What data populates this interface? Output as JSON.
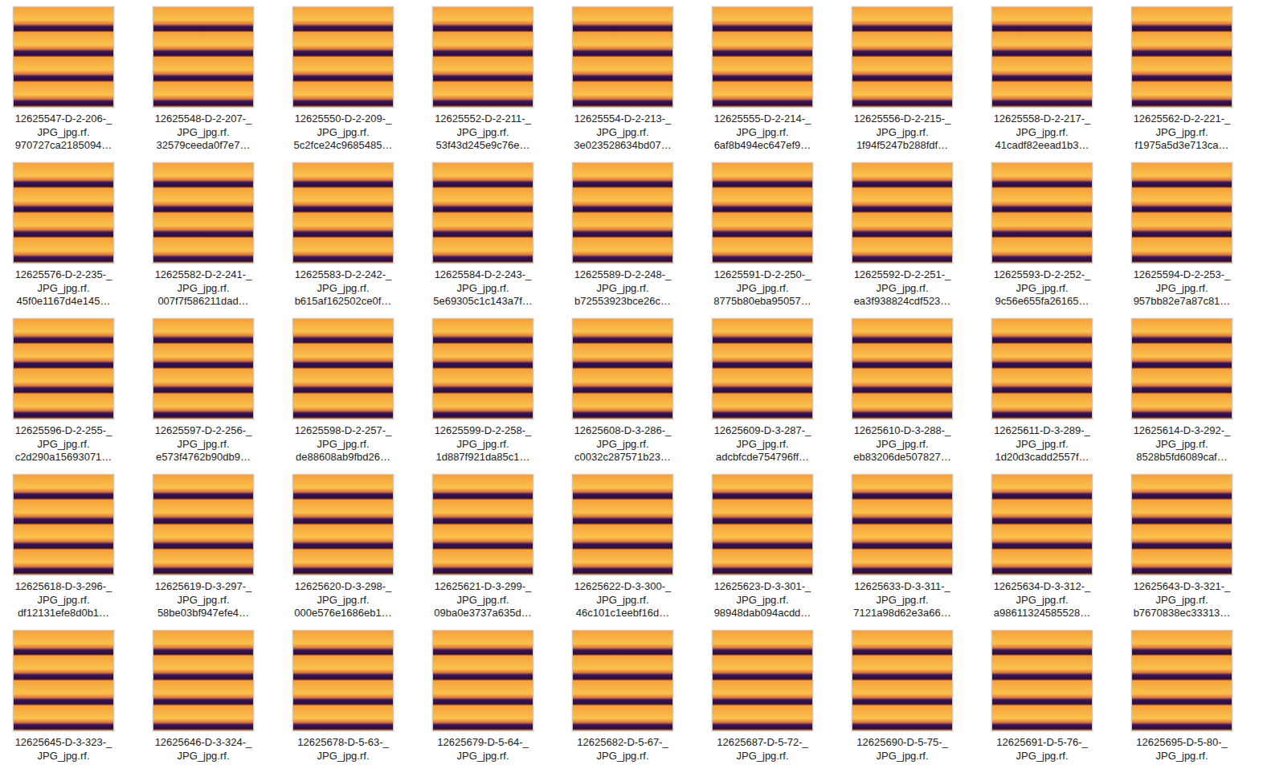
{
  "file_view": {
    "items": [
      {
        "lines": [
          "12625547-D-2-206-_",
          "JPG_jpg.rf.",
          "970727ca2185094…"
        ],
        "selected": false
      },
      {
        "lines": [
          "12625548-D-2-207-_",
          "JPG_jpg.rf.",
          "32579ceeda0f7e7…"
        ],
        "selected": false
      },
      {
        "lines": [
          "12625550-D-2-209-_",
          "JPG_jpg.rf.",
          "5c2fce24c9685485…"
        ],
        "selected": false
      },
      {
        "lines": [
          "12625552-D-2-211-_",
          "JPG_jpg.rf.",
          "53f43d245e9c76e…"
        ],
        "selected": false
      },
      {
        "lines": [
          "12625554-D-2-213-_",
          "JPG_jpg.rf.",
          "3e023528634bd07…"
        ],
        "selected": false
      },
      {
        "lines": [
          "12625555-D-2-214-_",
          "JPG_jpg.rf.",
          "6af8b494ec647ef9…"
        ],
        "selected": false
      },
      {
        "lines": [
          "12625556-D-2-215-_",
          "JPG_jpg.rf.",
          "1f94f5247b288fdf…"
        ],
        "selected": false
      },
      {
        "lines": [
          "12625558-D-2-217-_",
          "JPG_jpg.rf.",
          "41cadf82eead1b3…"
        ],
        "selected": false
      },
      {
        "lines": [
          "12625562-D-2-221-_",
          "JPG_jpg.rf.",
          "f1975a5d3e713ca…"
        ],
        "selected": false
      },
      {
        "lines": [
          "12625576-D-2-235-_",
          "JPG_jpg.rf.",
          "45f0e1167d4e145…"
        ],
        "selected": false
      },
      {
        "lines": [
          "12625582-D-2-241-_",
          "JPG_jpg.rf.",
          "007f7f586211dad…"
        ],
        "selected": false
      },
      {
        "lines": [
          "12625583-D-2-242-_",
          "JPG_jpg.rf.",
          "b615af162502ce0f…"
        ],
        "selected": false
      },
      {
        "lines": [
          "12625584-D-2-243-_",
          "JPG_jpg.rf.",
          "5e69305c1c143a7f…"
        ],
        "selected": false
      },
      {
        "lines": [
          "12625589-D-2-248-_",
          "JPG_jpg.rf.",
          "b72553923bce26c…"
        ],
        "selected": false
      },
      {
        "lines": [
          "12625591-D-2-250-_",
          "JPG_jpg.rf.",
          "8775b80eba95057…"
        ],
        "selected": false
      },
      {
        "lines": [
          "12625592-D-2-251-_",
          "JPG_jpg.rf.",
          "ea3f938824cdf523…"
        ],
        "selected": false
      },
      {
        "lines": [
          "12625593-D-2-252-_",
          "JPG_jpg.rf.",
          "9c56e655fa26165…"
        ],
        "selected": false
      },
      {
        "lines": [
          "12625594-D-2-253-_",
          "JPG_jpg.rf.",
          "957bb82e7a87c81…"
        ],
        "selected": false
      },
      {
        "lines": [
          "12625596-D-2-255-_",
          "JPG_jpg.rf.",
          "c2d290a15693071…"
        ],
        "selected": false
      },
      {
        "lines": [
          "12625597-D-2-256-_",
          "JPG_jpg.rf.",
          "e573f4762b90db9…"
        ],
        "selected": false
      },
      {
        "lines": [
          "12625598-D-2-257-_",
          "JPG_jpg.rf.",
          "de88608ab9fbd26…"
        ],
        "selected": false
      },
      {
        "lines": [
          "12625599-D-2-258-_",
          "JPG_jpg.rf.",
          "1d887f921da85c1…"
        ],
        "selected": false
      },
      {
        "lines": [
          "12625608-D-3-286-_",
          "JPG_jpg.rf.",
          "c0032c287571b23…"
        ],
        "selected": false
      },
      {
        "lines": [
          "12625609-D-3-287-_",
          "JPG_jpg.rf.",
          "adcbfcde754796ff…"
        ],
        "selected": false
      },
      {
        "lines": [
          "12625610-D-3-288-_",
          "JPG_jpg.rf.",
          "eb83206de507827…"
        ],
        "selected": false
      },
      {
        "lines": [
          "12625611-D-3-289-_",
          "JPG_jpg.rf.",
          "1d20d3cadd2557f…"
        ],
        "selected": false
      },
      {
        "lines": [
          "12625614-D-3-292-_",
          "JPG_jpg.rf.",
          "8528b5fd6089caf…"
        ],
        "selected": false
      },
      {
        "lines": [
          "12625618-D-3-296-_",
          "JPG_jpg.rf.",
          "df12131efe8d0b1…"
        ],
        "selected": false
      },
      {
        "lines": [
          "12625619-D-3-297-_",
          "JPG_jpg.rf.",
          "58be03bf947efe4…"
        ],
        "selected": false
      },
      {
        "lines": [
          "12625620-D-3-298-_",
          "JPG_jpg.rf.",
          "000e576e1686eb1…"
        ],
        "selected": false
      },
      {
        "lines": [
          "12625621-D-3-299-_",
          "JPG_jpg.rf.",
          "09ba0e3737a635d…"
        ],
        "selected": false
      },
      {
        "lines": [
          "12625622-D-3-300-_",
          "JPG_jpg.rf.",
          "46c101c1eebf16d…"
        ],
        "selected": false
      },
      {
        "lines": [
          "12625623-D-3-301-_",
          "JPG_jpg.rf.",
          "98948dab094acdd…"
        ],
        "selected": false
      },
      {
        "lines": [
          "12625633-D-3-311-_",
          "JPG_jpg.rf.",
          "7121a98d62e3a66…"
        ],
        "selected": false
      },
      {
        "lines": [
          "12625634-D-3-312-_",
          "JPG_jpg.rf.",
          "a98611324585528…"
        ],
        "selected": false
      },
      {
        "lines": [
          "12625643-D-3-321-_",
          "JPG_jpg.rf.",
          "b7670838ec33313…"
        ],
        "selected": false
      },
      {
        "lines": [
          "12625645-D-3-323-_",
          "JPG_jpg.rf."
        ],
        "selected": false
      },
      {
        "lines": [
          "12625646-D-3-324-_",
          "JPG_jpg.rf."
        ],
        "selected": false
      },
      {
        "lines": [
          "12625678-D-5-63-_",
          "JPG_jpg.rf."
        ],
        "selected": false
      },
      {
        "lines": [
          "12625679-D-5-64-_",
          "JPG_jpg.rf."
        ],
        "selected": false
      },
      {
        "lines": [
          "12625682-D-5-67-_",
          "JPG_jpg.rf."
        ],
        "selected": false
      },
      {
        "lines": [
          "12625687-D-5-72-_",
          "JPG_jpg.rf."
        ],
        "selected": false
      },
      {
        "lines": [
          "12625690-D-5-75-_",
          "JPG_jpg.rf."
        ],
        "selected": false
      },
      {
        "lines": [
          "12625691-D-5-76-_",
          "JPG_jpg.rf."
        ],
        "selected": false
      },
      {
        "lines": [
          "12625695-D-5-80-_",
          "JPG_jpg.rf."
        ],
        "selected": false
      }
    ]
  }
}
